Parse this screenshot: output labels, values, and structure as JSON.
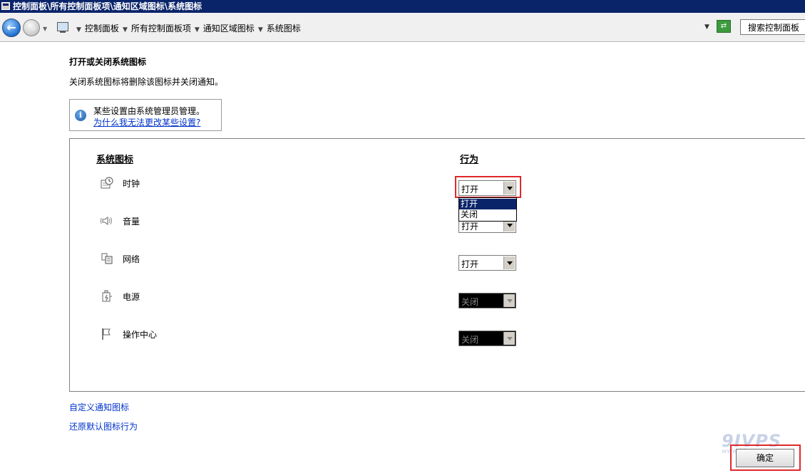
{
  "window": {
    "title": "控制面板\\所有控制面板项\\通知区域图标\\系统图标"
  },
  "address": {
    "crumbs": [
      "控制面板",
      "所有控制面板项",
      "通知区域图标",
      "系统图标"
    ],
    "search_placeholder": "搜索控制面板"
  },
  "main": {
    "heading": "打开或关闭系统图标",
    "description": "关闭系统图标将删除该图标并关闭通知。",
    "info_line1": "某些设置由系统管理员管理。",
    "info_link": "为什么我无法更改某些设置?",
    "col_icon": "系统图标",
    "col_behavior": "行为",
    "rows": [
      {
        "label": "时钟",
        "icon": "clock-icon",
        "value": "打开",
        "enabled": true
      },
      {
        "label": "音量",
        "icon": "volume-icon",
        "value": "打开",
        "enabled": true
      },
      {
        "label": "网络",
        "icon": "network-icon",
        "value": "打开",
        "enabled": true
      },
      {
        "label": "电源",
        "icon": "power-icon",
        "value": "关闭",
        "enabled": false
      },
      {
        "label": "操作中心",
        "icon": "action-center-flag-icon",
        "value": "关闭",
        "enabled": false
      }
    ],
    "dropdown_options": [
      "打开",
      "关闭"
    ],
    "dropdown_highlighted": "打开"
  },
  "links": {
    "customize": "自定义通知图标",
    "restore": "还原默认图标行为"
  },
  "footer": {
    "ok_label": "确定"
  },
  "watermark": {
    "brand": "9IVPS",
    "url": "www.91vps.com"
  },
  "colors": {
    "title_bar": "#0a246a",
    "link": "#0033cc",
    "highlight_box": "#e0282b",
    "selection": "#0a246a"
  }
}
